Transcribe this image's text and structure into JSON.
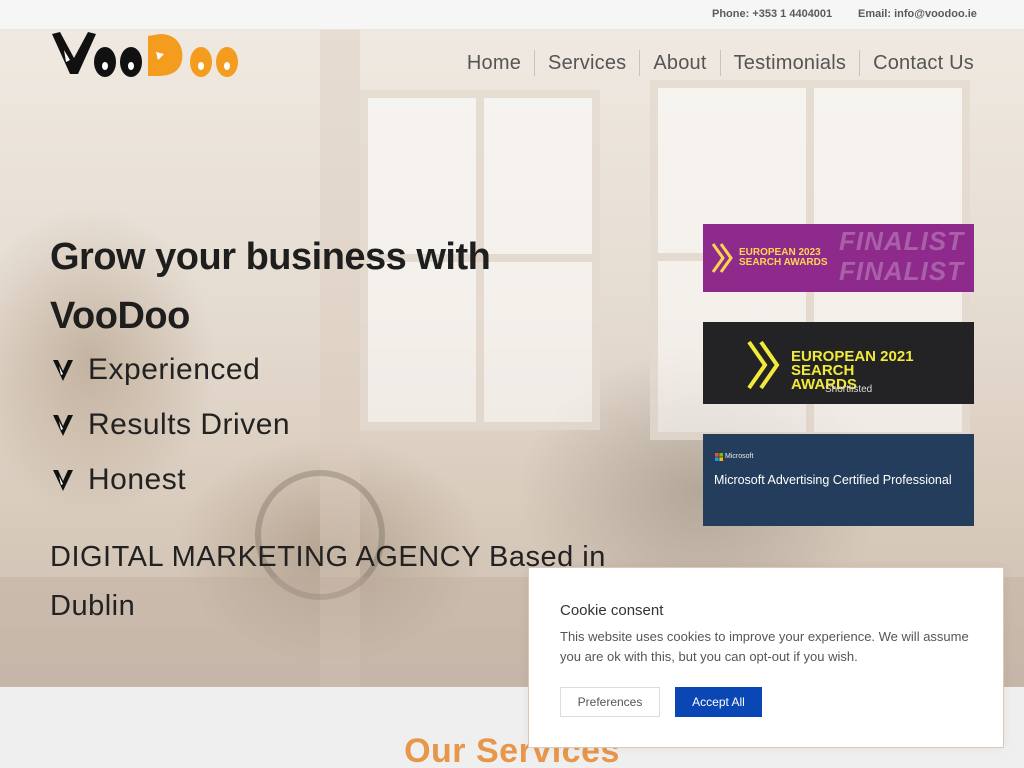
{
  "topbar": {
    "phone": "Phone: +353 1 4404001",
    "email": "Email: info@voodoo.ie"
  },
  "brand": {
    "name": "VooDoo",
    "colors": {
      "dark": "#111111",
      "accent": "#f39c1e"
    }
  },
  "nav": {
    "items": [
      {
        "label": "Home"
      },
      {
        "label": "Services"
      },
      {
        "label": "About"
      },
      {
        "label": "Testimonials"
      },
      {
        "label": "Contact Us"
      }
    ]
  },
  "hero": {
    "headline": "Grow your business with VooDoo",
    "features": [
      "Experienced",
      "Results Driven",
      "Honest"
    ],
    "tagline": "DIGITAL MARKETING AGENCY  Based in Dublin",
    "feature_icon": "chevron-down-icon"
  },
  "awards": [
    {
      "title": "EUROPEAN 2023 SEARCH AWARDS",
      "badge": "FINALIST",
      "color": "#8e2a8c"
    },
    {
      "title": "EUROPEAN 2021 SEARCH AWARDS",
      "subtitle": "Shortlisted",
      "color": "#232325"
    },
    {
      "brand": "Microsoft",
      "title": "Microsoft Advertising Certified Professional",
      "color": "#253d5c"
    }
  ],
  "services": {
    "title": "Our Services",
    "accent": "#e8964a"
  },
  "cookie": {
    "title": "Cookie consent",
    "body": "This website uses cookies to improve your experience. We will assume you are ok with this, but you can opt-out if you wish.",
    "preferences_label": "Preferences",
    "accept_label": "Accept All",
    "accept_color": "#0b47b4"
  }
}
